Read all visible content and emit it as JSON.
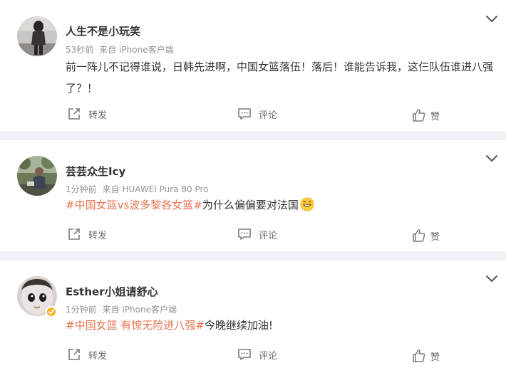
{
  "actions": {
    "repost_label": "转发",
    "comment_label": "评论",
    "like_label": "赞"
  },
  "comments": [
    {
      "username": "人生不是小玩笑",
      "time": "53秒前",
      "source": "来自 iPhone客户端",
      "text": "前一阵儿不记得谁说，日韩先进啊，中国女篮落伍！落后！谁能告诉我，这仨队伍谁进八强了？！"
    },
    {
      "username": "芸芸众生Icy",
      "time": "1分钟前",
      "source": "来自 HUAWEI Pura 80 Pro",
      "hashtag_1": "#中国女篮vs波多黎各女篮#",
      "text": "为什么偏偏要对法国",
      "emoji": "grinning-face-emoji"
    },
    {
      "username": "Esther小姐请舒心",
      "time": "1分钟前",
      "source": "来自 iPhone客户端",
      "hashtag_1": "#中国女篮 有惊无险进八强#",
      "text": "今晚继续加油!",
      "verified_badge": "verified-icon"
    }
  ],
  "colors": {
    "hashtag": "#eb7350",
    "background": "#f0f1f4",
    "card": "#ffffff",
    "meta_text": "#939393",
    "verified": "#f9b31b"
  },
  "icons": {
    "menu": "chevron-down-icon",
    "repost": "share-icon",
    "comment": "comment-icon",
    "like": "thumbs-up-icon"
  }
}
